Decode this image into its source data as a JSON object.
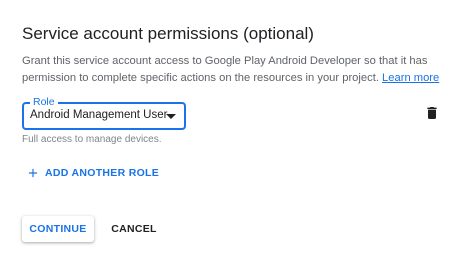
{
  "section": {
    "title": "Service account permissions (optional)",
    "description": "Grant this service account access to Google Play Android Developer so that it has permission to complete specific actions on the resources in your project.",
    "learn_more": "Learn more"
  },
  "role_field": {
    "label": "Role",
    "value": "Android Management User",
    "hint": "Full access to manage devices."
  },
  "actions": {
    "add_role": "ADD ANOTHER ROLE",
    "continue": "CONTINUE",
    "cancel": "CANCEL"
  },
  "icons": {
    "delete": "trash-icon",
    "add": "plus-icon",
    "dropdown": "dropdown-arrow-icon"
  },
  "colors": {
    "accent": "#1a73e8",
    "text": "#202124",
    "secondary_text": "#5f6368"
  }
}
